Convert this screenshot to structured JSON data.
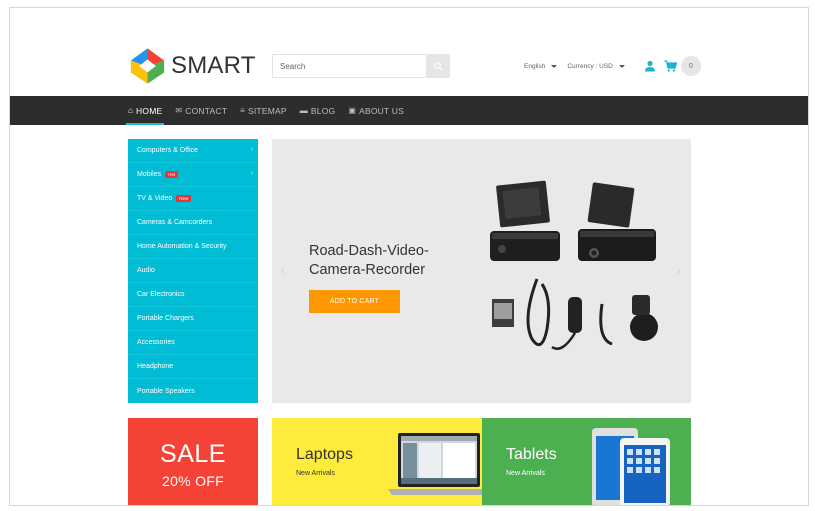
{
  "header": {
    "logo_text": "SMART",
    "search_placeholder": "Search",
    "language": "English",
    "currency": "Currency : USD",
    "cart_count": "0"
  },
  "nav": [
    {
      "label": "HOME",
      "icon": "home-icon",
      "active": true
    },
    {
      "label": "CONTACT",
      "icon": "envelope-icon",
      "active": false
    },
    {
      "label": "SITEMAP",
      "icon": "list-icon",
      "active": false
    },
    {
      "label": "BLOG",
      "icon": "blog-icon",
      "active": false
    },
    {
      "label": "ABOUT US",
      "icon": "info-icon",
      "active": false
    }
  ],
  "categories": [
    {
      "label": "Computers & Office",
      "arrow": true
    },
    {
      "label": "Mobiles",
      "badge": "Hot",
      "arrow": true
    },
    {
      "label": "TV & Video",
      "badge": "New"
    },
    {
      "label": "Cameras & Camcorders"
    },
    {
      "label": "Home Automation & Security"
    },
    {
      "label": "Audio"
    },
    {
      "label": "Car Electronics"
    },
    {
      "label": "Portable Chargers"
    },
    {
      "label": "Accessories"
    },
    {
      "label": "Headphone"
    },
    {
      "label": "Portable Speakers"
    }
  ],
  "slider": {
    "title_line1": "Road-Dash-Video-",
    "title_line2": "Camera-Recorder",
    "button": "ADD TO CART",
    "prev": "‹",
    "next": "›"
  },
  "banners": {
    "sale_big": "SALE",
    "sale_small": "20% OFF",
    "laptops_title": "Laptops",
    "laptops_sub": "New Arrivals",
    "tablets_title": "Tablets",
    "tablets_sub": "New Arrivals"
  },
  "colors": {
    "accent": "#00bcd4",
    "navbar": "#2d2d2d",
    "cta": "#ff9800",
    "sale": "#f44336",
    "laptops": "#ffeb3b",
    "tablets": "#4caf50"
  }
}
